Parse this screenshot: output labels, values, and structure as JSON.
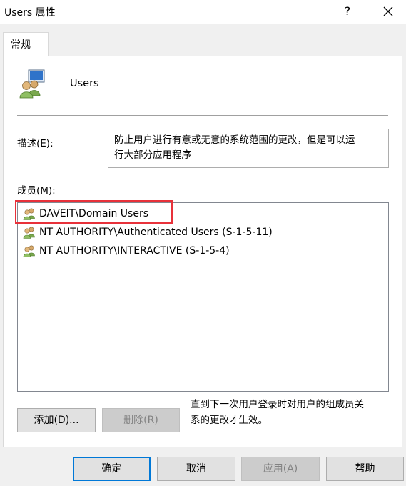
{
  "window": {
    "title": "Users 属性",
    "help_glyph": "?"
  },
  "tabs": [
    {
      "label": "常规",
      "active": true
    }
  ],
  "group": {
    "name": "Users",
    "icon": "group-users-icon"
  },
  "description": {
    "label": "描述(E):",
    "text_line1": "防止用户进行有意或无意的系统范围的更改，但是可以运",
    "text_line2": "行大部分应用程序"
  },
  "members": {
    "label": "成员(M):",
    "items": [
      {
        "name": "DAVEIT\\Domain Users",
        "icon": "group-icon",
        "highlighted": true
      },
      {
        "name": "NT AUTHORITY\\Authenticated Users (S-1-5-11)",
        "icon": "group-icon"
      },
      {
        "name": "NT AUTHORITY\\INTERACTIVE (S-1-5-4)",
        "icon": "group-icon"
      }
    ]
  },
  "buttons": {
    "add": "添加(D)...",
    "remove": "删除(R)",
    "ok": "确定",
    "cancel": "取消",
    "apply": "应用(A)",
    "help": "帮助"
  },
  "note": {
    "line1": "直到下一次用户登录时对用户的组成员关",
    "line2": "系的更改才生效。"
  },
  "colors": {
    "highlight_border": "#e8313a",
    "accent": "#0078d7"
  }
}
